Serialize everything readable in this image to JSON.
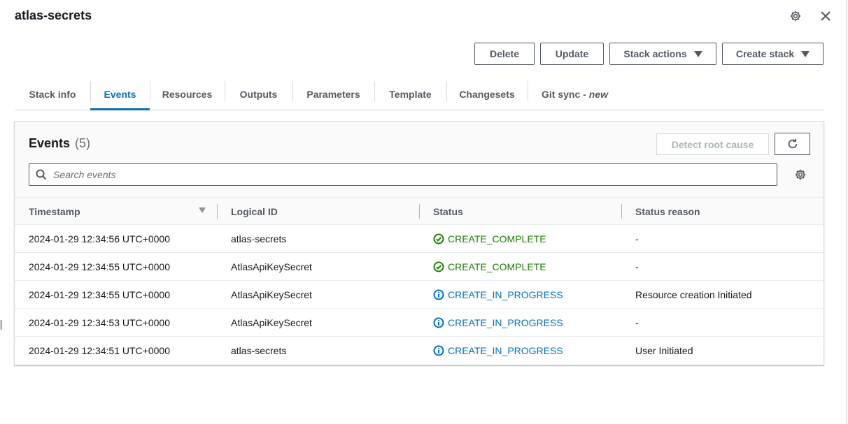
{
  "header": {
    "title": "atlas-secrets",
    "settings_icon": "gear-icon",
    "close_icon": "close-icon"
  },
  "toolbar": {
    "delete_label": "Delete",
    "update_label": "Update",
    "stack_actions_label": "Stack actions",
    "create_stack_label": "Create stack"
  },
  "tabs": [
    {
      "label": "Stack info"
    },
    {
      "label": "Events",
      "active": true
    },
    {
      "label": "Resources"
    },
    {
      "label": "Outputs"
    },
    {
      "label": "Parameters"
    },
    {
      "label": "Template"
    },
    {
      "label": "Changesets"
    },
    {
      "label": "Git sync",
      "suffix": "- new"
    }
  ],
  "events": {
    "title": "Events",
    "count": "(5)",
    "detect_label": "Detect root cause",
    "search_placeholder": "Search events",
    "columns": [
      "Timestamp",
      "Logical ID",
      "Status",
      "Status reason"
    ],
    "rows": [
      {
        "timestamp": "2024-01-29 12:34:56 UTC+0000",
        "logical_id": "atlas-secrets",
        "status": "CREATE_COMPLETE",
        "status_type": "complete",
        "reason": "-"
      },
      {
        "timestamp": "2024-01-29 12:34:55 UTC+0000",
        "logical_id": "AtlasApiKeySecret",
        "status": "CREATE_COMPLETE",
        "status_type": "complete",
        "reason": "-"
      },
      {
        "timestamp": "2024-01-29 12:34:55 UTC+0000",
        "logical_id": "AtlasApiKeySecret",
        "status": "CREATE_IN_PROGRESS",
        "status_type": "progress",
        "reason": "Resource creation Initiated"
      },
      {
        "timestamp": "2024-01-29 12:34:53 UTC+0000",
        "logical_id": "AtlasApiKeySecret",
        "status": "CREATE_IN_PROGRESS",
        "status_type": "progress",
        "reason": "-"
      },
      {
        "timestamp": "2024-01-29 12:34:51 UTC+0000",
        "logical_id": "atlas-secrets",
        "status": "CREATE_IN_PROGRESS",
        "status_type": "progress",
        "reason": "User Initiated"
      }
    ]
  },
  "colors": {
    "accent": "#0073bb",
    "success": "#1d8102",
    "text": "#16191f",
    "muted": "#545b64"
  }
}
